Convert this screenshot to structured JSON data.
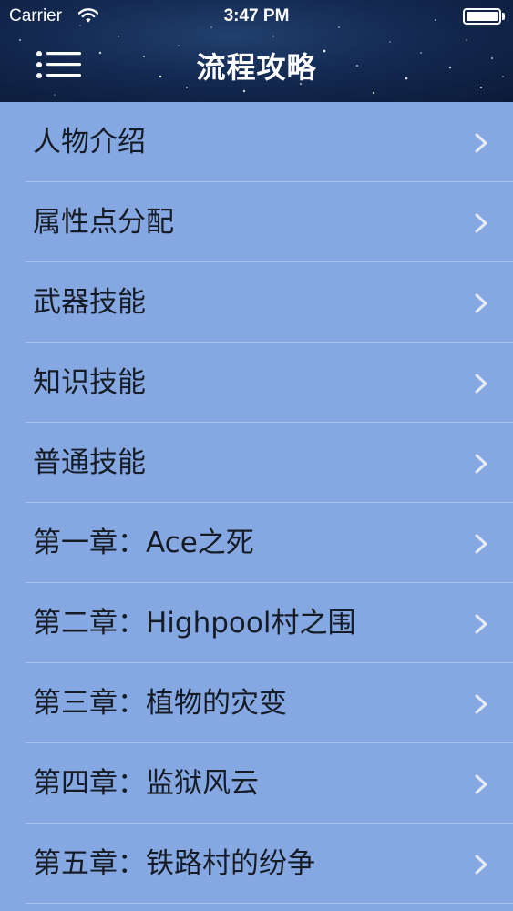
{
  "status_bar": {
    "carrier": "Carrier",
    "time": "3:47 PM",
    "battery_level": 1.0
  },
  "nav_bar": {
    "title": "流程攻略",
    "menu_icon": "menu-list-icon"
  },
  "list": {
    "chevron_icon": "chevron-right-icon",
    "items": [
      {
        "label": "人物介绍"
      },
      {
        "label": "属性点分配"
      },
      {
        "label": "武器技能"
      },
      {
        "label": "知识技能"
      },
      {
        "label": "普通技能"
      },
      {
        "label": "第一章：Ace之死"
      },
      {
        "label": "第二章：Highpool村之围"
      },
      {
        "label": "第三章：植物的灾变"
      },
      {
        "label": "第四章：监狱风云"
      },
      {
        "label": "第五章：铁路村的纷争"
      }
    ]
  },
  "colors": {
    "list_background": "#86a8e2",
    "separator": "#a9c1ec",
    "text": "#161c26",
    "chevron": "#e6ecf6",
    "header_background": "#142a52"
  }
}
